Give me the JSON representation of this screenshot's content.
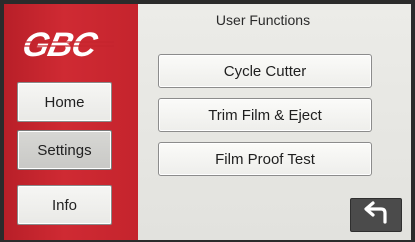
{
  "brand": {
    "logo_text": "GBC",
    "sidebar_color": "#c5242d"
  },
  "sidebar": {
    "items": [
      {
        "label": "Home",
        "active": false
      },
      {
        "label": "Settings",
        "active": true
      },
      {
        "label": "Info",
        "active": false
      }
    ]
  },
  "main": {
    "title": "User Functions",
    "actions": [
      {
        "label": "Cycle Cutter"
      },
      {
        "label": "Trim Film & Eject"
      },
      {
        "label": "Film Proof Test"
      }
    ],
    "back_icon": "back-arrow-icon"
  }
}
